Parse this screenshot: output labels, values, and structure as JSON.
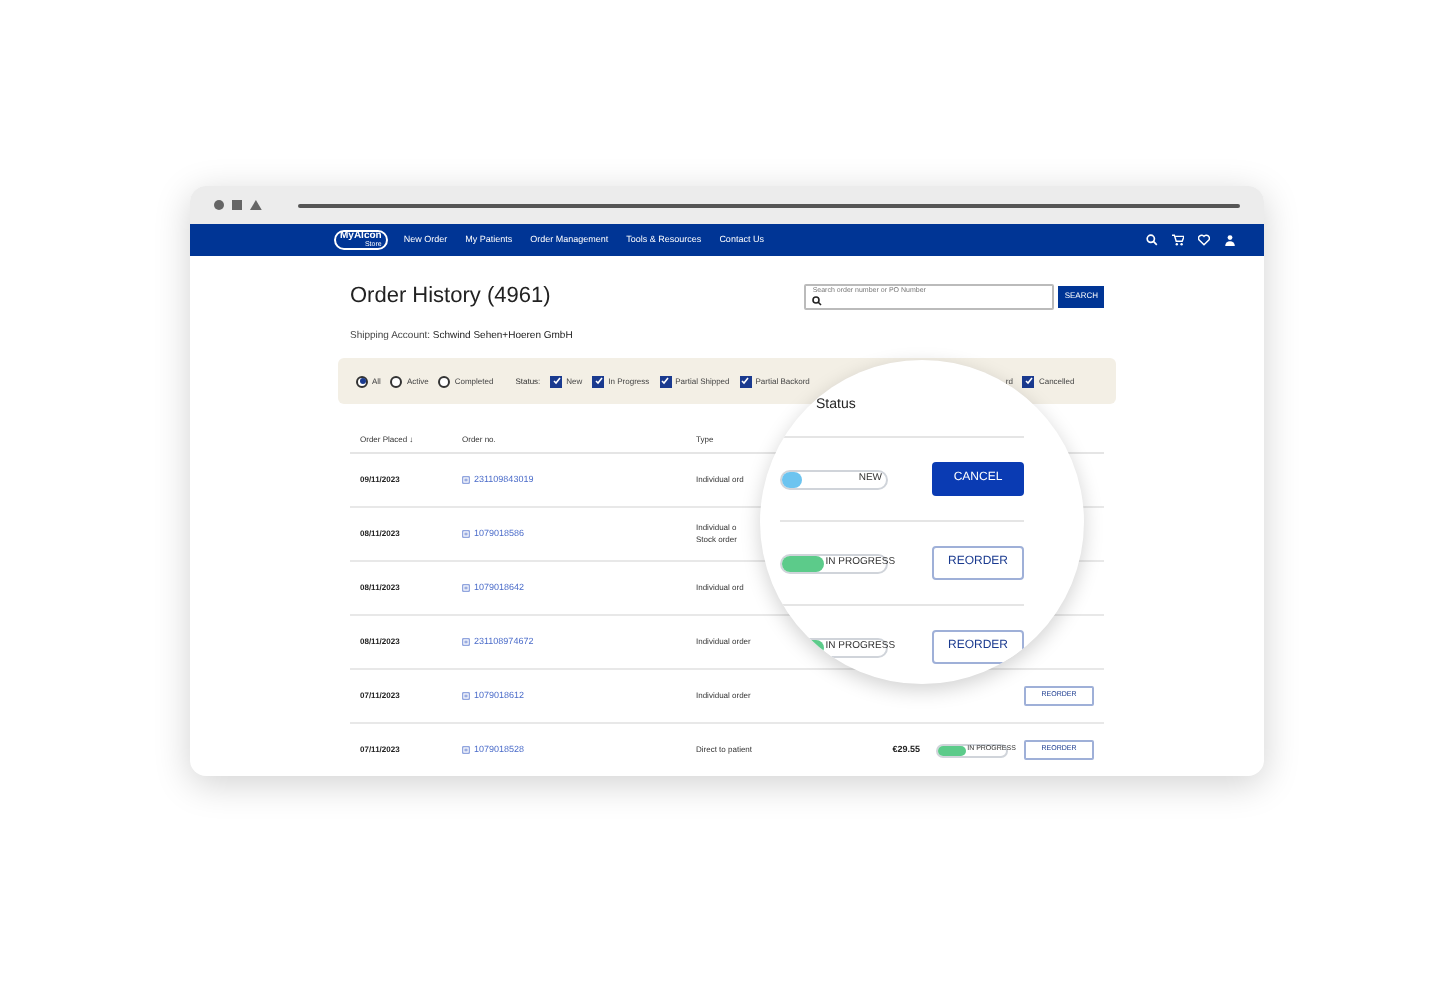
{
  "logo": {
    "name": "MyAlcon",
    "sub": "Store"
  },
  "nav": [
    "New Order",
    "My Patients",
    "Order Management",
    "Tools & Resources",
    "Contact Us"
  ],
  "title": "Order History (4961)",
  "search": {
    "placeholder": "Search order number or PO Number",
    "button": "SEARCH"
  },
  "shipping": {
    "label": "Shipping Account:",
    "value": "Schwind Sehen+Hoeren GmbH"
  },
  "filters": {
    "radios": [
      {
        "label": "All",
        "selected": true
      },
      {
        "label": "Active",
        "selected": false
      },
      {
        "label": "Completed",
        "selected": false
      }
    ],
    "status_label": "Status:",
    "checks": [
      {
        "label": "New",
        "checked": true
      },
      {
        "label": "In Progress",
        "checked": true
      },
      {
        "label": "Partial Shipped",
        "checked": true
      },
      {
        "label": "Partial Backord",
        "checked": true
      }
    ],
    "right_fragment": "rd",
    "right_check": {
      "label": "Cancelled",
      "checked": true
    }
  },
  "columns": [
    "Order Placed ↓",
    "Order no.",
    "Type"
  ],
  "rows": [
    {
      "date": "09/11/2023",
      "order": "231109843019",
      "type": [
        "Individual ord"
      ]
    },
    {
      "date": "08/11/2023",
      "order": "1079018586",
      "type": [
        "Individual o",
        "Stock order"
      ]
    },
    {
      "date": "08/11/2023",
      "order": "1079018642",
      "type": [
        "Individual ord"
      ]
    },
    {
      "date": "08/11/2023",
      "order": "231108974672",
      "type": [
        "Individual order"
      ]
    },
    {
      "date": "07/11/2023",
      "order": "1079018612",
      "type": [
        "Individual order"
      ],
      "action": "REORDER"
    },
    {
      "date": "07/11/2023",
      "order": "1079018528",
      "type": [
        "Direct to patient"
      ],
      "amount": "€29.55",
      "status": {
        "label": "IN PROGRESS",
        "color": "#5ccb8a",
        "level": 0.4
      },
      "action": "REORDER"
    }
  ],
  "magnifier": {
    "header": "Status",
    "rows": [
      {
        "status": {
          "label": "NEW",
          "color": "#6cc4f0",
          "level": 0.2
        },
        "action": {
          "label": "CANCEL",
          "kind": "primary"
        }
      },
      {
        "status": {
          "label": "IN PROGRESS",
          "color": "#5ccb8a",
          "level": 0.4
        },
        "action": {
          "label": "REORDER",
          "kind": "outline"
        }
      },
      {
        "status": {
          "label": "IN PROGRESS",
          "color": "#5ccb8a",
          "level": 0.4
        },
        "action": {
          "label": "REORDER",
          "kind": "outline"
        }
      }
    ]
  }
}
